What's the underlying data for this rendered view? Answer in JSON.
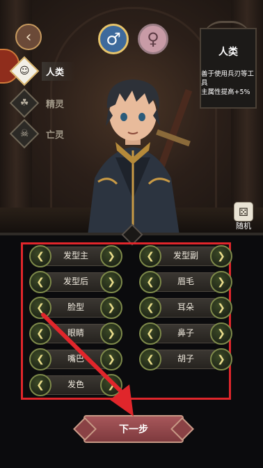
{
  "header": {
    "back_icon": "back-chevron-icon",
    "male_icon": "male-symbol-icon",
    "female_icon": "female-symbol-icon"
  },
  "races": [
    {
      "label": "人类",
      "icon": "human-icon",
      "active": true
    },
    {
      "label": "精灵",
      "icon": "elf-icon",
      "active": false
    },
    {
      "label": "亡灵",
      "icon": "undead-icon",
      "active": false
    }
  ],
  "info": {
    "title": "人类",
    "description": "善于使用兵刃等工具\n主属性提高+5%"
  },
  "random": {
    "label": "随机",
    "icon": "dice-icon"
  },
  "options": [
    {
      "label": "发型主"
    },
    {
      "label": "发型副"
    },
    {
      "label": "发型后"
    },
    {
      "label": "眉毛"
    },
    {
      "label": "脸型"
    },
    {
      "label": "耳朵"
    },
    {
      "label": "眼睛"
    },
    {
      "label": "鼻子"
    },
    {
      "label": "嘴巴"
    },
    {
      "label": "胡子"
    },
    {
      "label": "发色"
    }
  ],
  "next_button": {
    "label": "下一步"
  },
  "colors": {
    "highlight": "#e0262b",
    "accent": "#e7c46b"
  }
}
